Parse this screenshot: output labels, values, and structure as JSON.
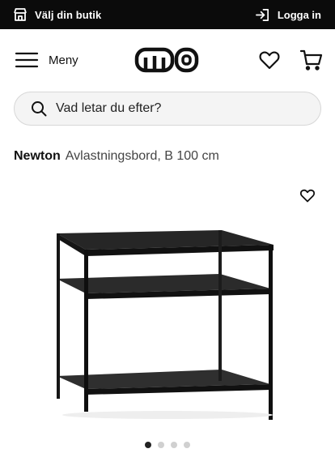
{
  "topbar": {
    "store_label": "Välj din butik",
    "login_label": "Logga in"
  },
  "header": {
    "menu_label": "Meny",
    "logo_text": "mio"
  },
  "search": {
    "placeholder": "Vad letar du efter?"
  },
  "product": {
    "brand": "Newton",
    "description": "Avlastningsbord, B 100 cm"
  },
  "carousel": {
    "total": 4,
    "active_index": 0
  },
  "colors": {
    "topbar_bg": "#0b0b0b",
    "search_bg": "#f4f4f4",
    "dot_active": "#222222",
    "dot_inactive": "#d0d0d0"
  }
}
